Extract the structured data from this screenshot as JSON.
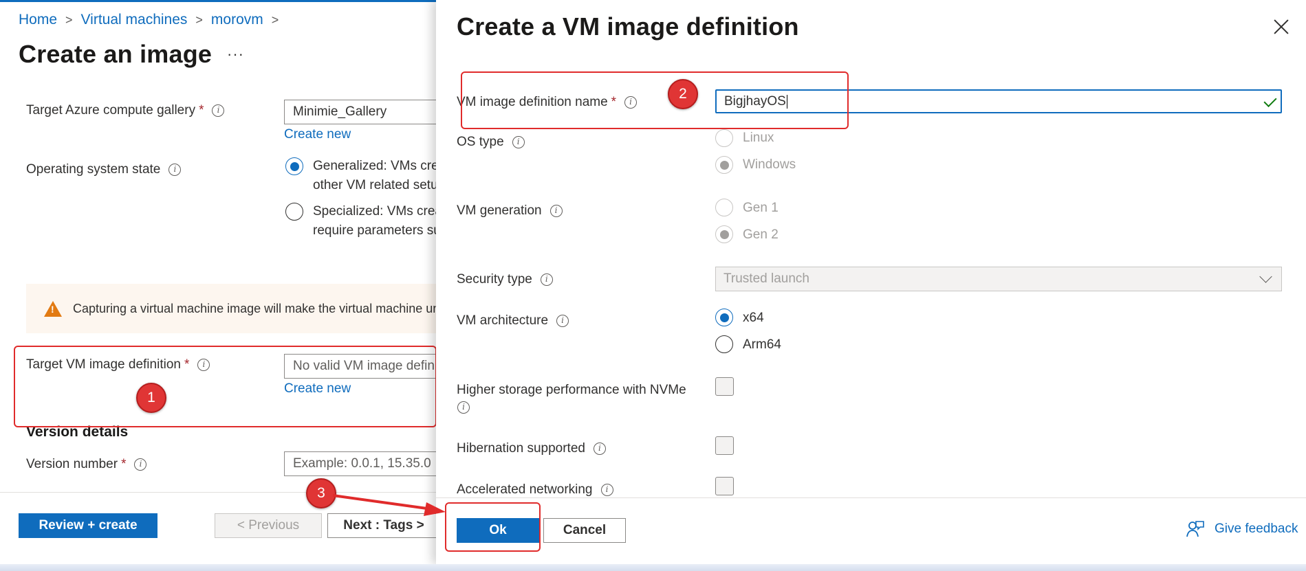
{
  "breadcrumb": {
    "items": [
      "Home",
      "Virtual machines",
      "morovm"
    ],
    "separator": ">"
  },
  "page": {
    "title": "Create an image",
    "more": "···"
  },
  "form": {
    "gallery": {
      "label": "Target Azure compute gallery",
      "value": "Minimie_Gallery",
      "create_new": "Create new"
    },
    "os_state": {
      "label": "Operating system state",
      "options": [
        {
          "line1": "Generalized: VMs cre",
          "line2": "other VM related setu",
          "selected": true
        },
        {
          "line1": "Specialized: VMs crea",
          "line2": "require parameters su",
          "selected": false
        }
      ]
    },
    "warning": "Capturing a virtual machine image will make the virtual machine unusable",
    "image_definition": {
      "label": "Target VM image definition",
      "placeholder": "No valid VM image definitions",
      "create_new": "Create new"
    },
    "version_section": "Version details",
    "version_number": {
      "label": "Version number",
      "placeholder": "Example: 0.0.1, 15.35.0"
    }
  },
  "footer": {
    "review_create": "Review + create",
    "previous": "< Previous",
    "next": "Next : Tags >"
  },
  "panel": {
    "title": "Create a VM image definition",
    "name_field": {
      "label": "VM image definition name",
      "value": "BigjhayOS"
    },
    "os_type": {
      "label": "OS type",
      "options": [
        "Linux",
        "Windows"
      ],
      "selected": "Windows"
    },
    "vm_generation": {
      "label": "VM generation",
      "options": [
        "Gen 1",
        "Gen 2"
      ],
      "selected": "Gen 2"
    },
    "security_type": {
      "label": "Security type",
      "value": "Trusted launch"
    },
    "vm_architecture": {
      "label": "VM architecture",
      "options": [
        "x64",
        "Arm64"
      ],
      "selected": "x64"
    },
    "nvme": {
      "label": "Higher storage performance with NVMe",
      "checked": false
    },
    "hibernation": {
      "label": "Hibernation supported",
      "checked": false
    },
    "accelerated": {
      "label": "Accelerated networking",
      "checked": false
    },
    "ok": "Ok",
    "cancel": "Cancel",
    "feedback": "Give feedback"
  },
  "annotations": {
    "step1": "1",
    "step2": "2",
    "step3": "3"
  },
  "colors": {
    "accent": "#0f6cbd",
    "annotation_red": "#e02b2b",
    "warning": "#e27a12",
    "valid": "#107c10"
  }
}
